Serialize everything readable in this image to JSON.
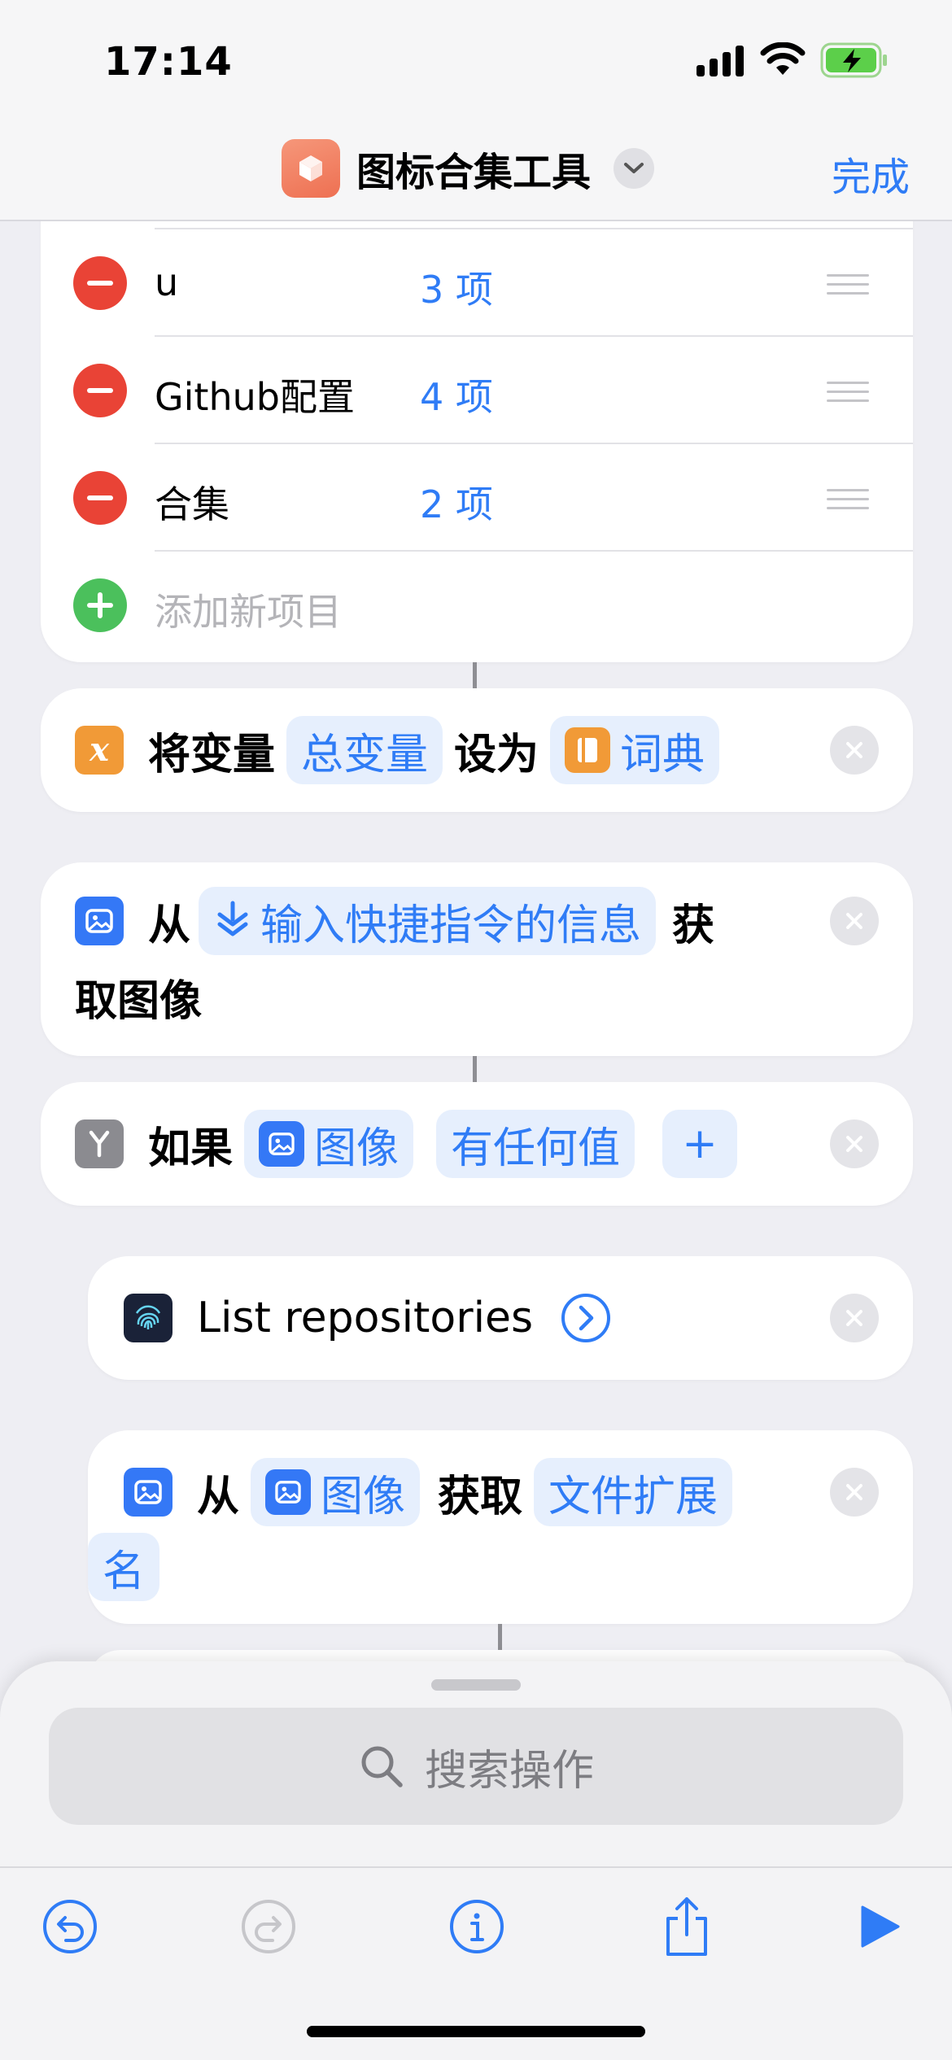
{
  "status_bar": {
    "time": "17:14"
  },
  "nav": {
    "title": "图标合集工具",
    "done_label": "完成"
  },
  "dict_items": [
    {
      "key": "u",
      "value": "3 项"
    },
    {
      "key": "Github配置",
      "value": "4 项"
    },
    {
      "key": "合集",
      "value": "2 项"
    }
  ],
  "add_item_label": "添加新项目",
  "actions": {
    "set_variable": {
      "verb": "将变量",
      "variable": "总变量",
      "connector": "设为",
      "value": "词典"
    },
    "get_images": {
      "from": "从",
      "source": "输入快捷指令的信息",
      "tail1": "获",
      "tail2": "取图像"
    },
    "if": {
      "verb": "如果",
      "input": "图像",
      "condition": "有任何值",
      "add": "+"
    },
    "list_repos": {
      "label": "List repositories"
    },
    "get_file_ext": {
      "from": "从",
      "source": "图像",
      "verb": "获取",
      "token1": "文件扩展",
      "token2": "名"
    }
  },
  "search": {
    "placeholder": "搜索操作"
  },
  "colors": {
    "accent": "#2f7cf6",
    "remove": "#e94336",
    "add": "#4bc05c",
    "variable_orange": "#f19a37"
  }
}
